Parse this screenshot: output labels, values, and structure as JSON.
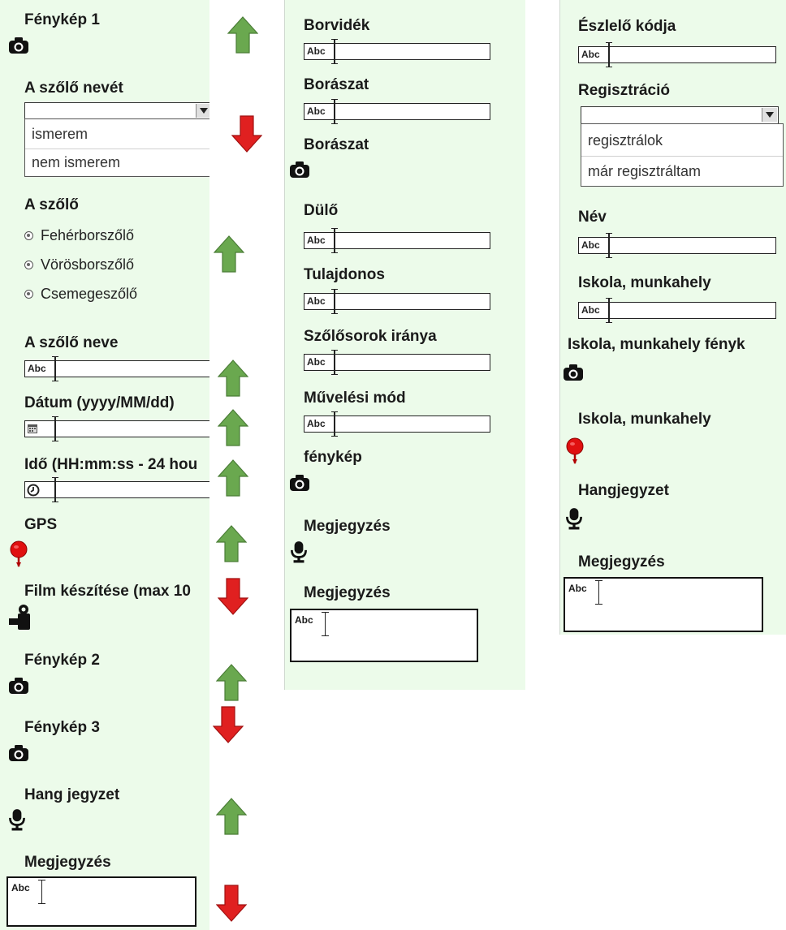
{
  "col1": {
    "photo1_label": "Fénykép 1",
    "grape_name_known_label": "A szőlő nevét",
    "grape_name_known_options": [
      "ismerem",
      "nem ismerem"
    ],
    "grape_type_label": "A szőlő",
    "grape_type_options": [
      "Fehérborszőlő",
      "Vörösborszőlő",
      "Csemegeszőlő"
    ],
    "grape_name_label": "A szőlő neve",
    "date_label": "Dátum (yyyy/MM/dd)",
    "time_label": "Idő (HH:mm:ss - 24 hou",
    "gps_label": "GPS",
    "film_label": "Film készítése (max 10",
    "photo2_label": "Fénykép 2",
    "photo3_label": "Fénykép 3",
    "audio_label": "Hang jegyzet",
    "note_label": "Megjegyzés"
  },
  "col2": {
    "wine_region_label": "Borvidék",
    "winery_label": "Borászat",
    "winery_photo_label": "Borászat",
    "vineyard_label": "Dülő",
    "owner_label": "Tulajdonos",
    "row_direction_label": "Szőlősorok iránya",
    "cultivation_label": "Művelési mód",
    "photo_label": "fénykép",
    "audio_note_label": "Megjegyzés",
    "note_label": "Megjegyzés"
  },
  "col3": {
    "observer_code_label": "Észlelő kódja",
    "registration_label": "Regisztráció",
    "registration_options": [
      "regisztrálok",
      "már regisztráltam"
    ],
    "name_label": "Név",
    "school_label": "Iskola, munkahely",
    "school_photo_label": "Iskola, munkahely fényk",
    "school_location_label": "Iskola, munkahely",
    "audio_label": "Hangjegyzet",
    "note_label": "Megjegyzés"
  },
  "field_placeholder": "Abc",
  "icons": [
    "camera-icon",
    "calendar-icon",
    "clock-icon",
    "map-pin-icon",
    "video-camera-icon",
    "microphone-icon",
    "arrow-up-icon",
    "arrow-down-icon"
  ],
  "colors": {
    "panel_bg": "#ecfbea",
    "arrow_up": "#6aa84f",
    "arrow_down": "#e02020",
    "pin": "#e01010"
  }
}
